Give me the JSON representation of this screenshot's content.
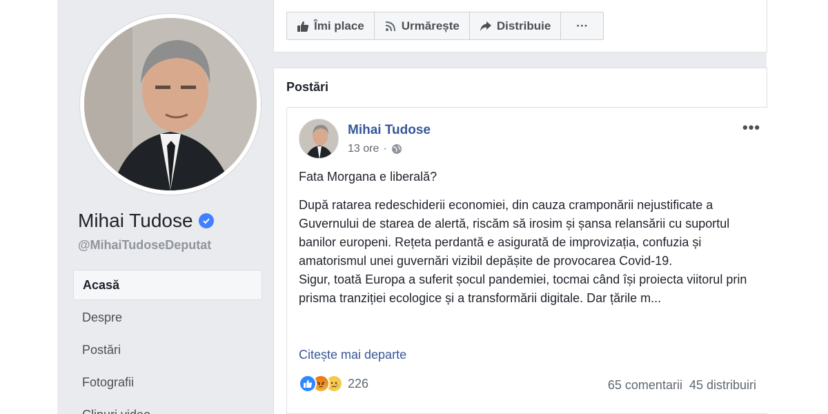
{
  "profile": {
    "name": "Mihai Tudose",
    "handle": "@MihaiTudoseDeputat"
  },
  "nav": {
    "items": [
      {
        "label": "Acasă",
        "active": true
      },
      {
        "label": "Despre"
      },
      {
        "label": "Postări"
      },
      {
        "label": "Fotografii"
      },
      {
        "label": "Clipuri video"
      }
    ]
  },
  "actions": {
    "like_label": "Îmi place",
    "follow_label": "Urmărește",
    "share_label": "Distribuie",
    "more_label": "···"
  },
  "posts": {
    "section_title": "Postări",
    "post": {
      "author": "Mihai Tudose",
      "time": "13 ore",
      "separator": "·",
      "more": "•••",
      "title": "Fata Morgana e liberală?",
      "body_p1": "După ratarea redeschiderii economiei, din cauza cramponării nejustificate a Guvernului de starea de alertă, riscăm să irosim și șansa relansării cu suportul banilor europeni. Rețeta perdantă e asigurată de improvizația, confuzia și amatorismul unei guvernări vizibil depășite de provocarea Covid-19.",
      "body_p2": "Sigur, toată Europa a suferit șocul pandemiei, tocmai când își proiecta viitorul prin prisma tranziției ecologice și a transformării digitale. Dar țările m...",
      "read_more": "Citește mai departe",
      "reaction_count": "226",
      "comments": "65 comentarii",
      "shares": "45 distribuiri"
    }
  },
  "colors": {
    "link": "#365899",
    "background": "#e9ebee",
    "verified": "#4080ff"
  }
}
